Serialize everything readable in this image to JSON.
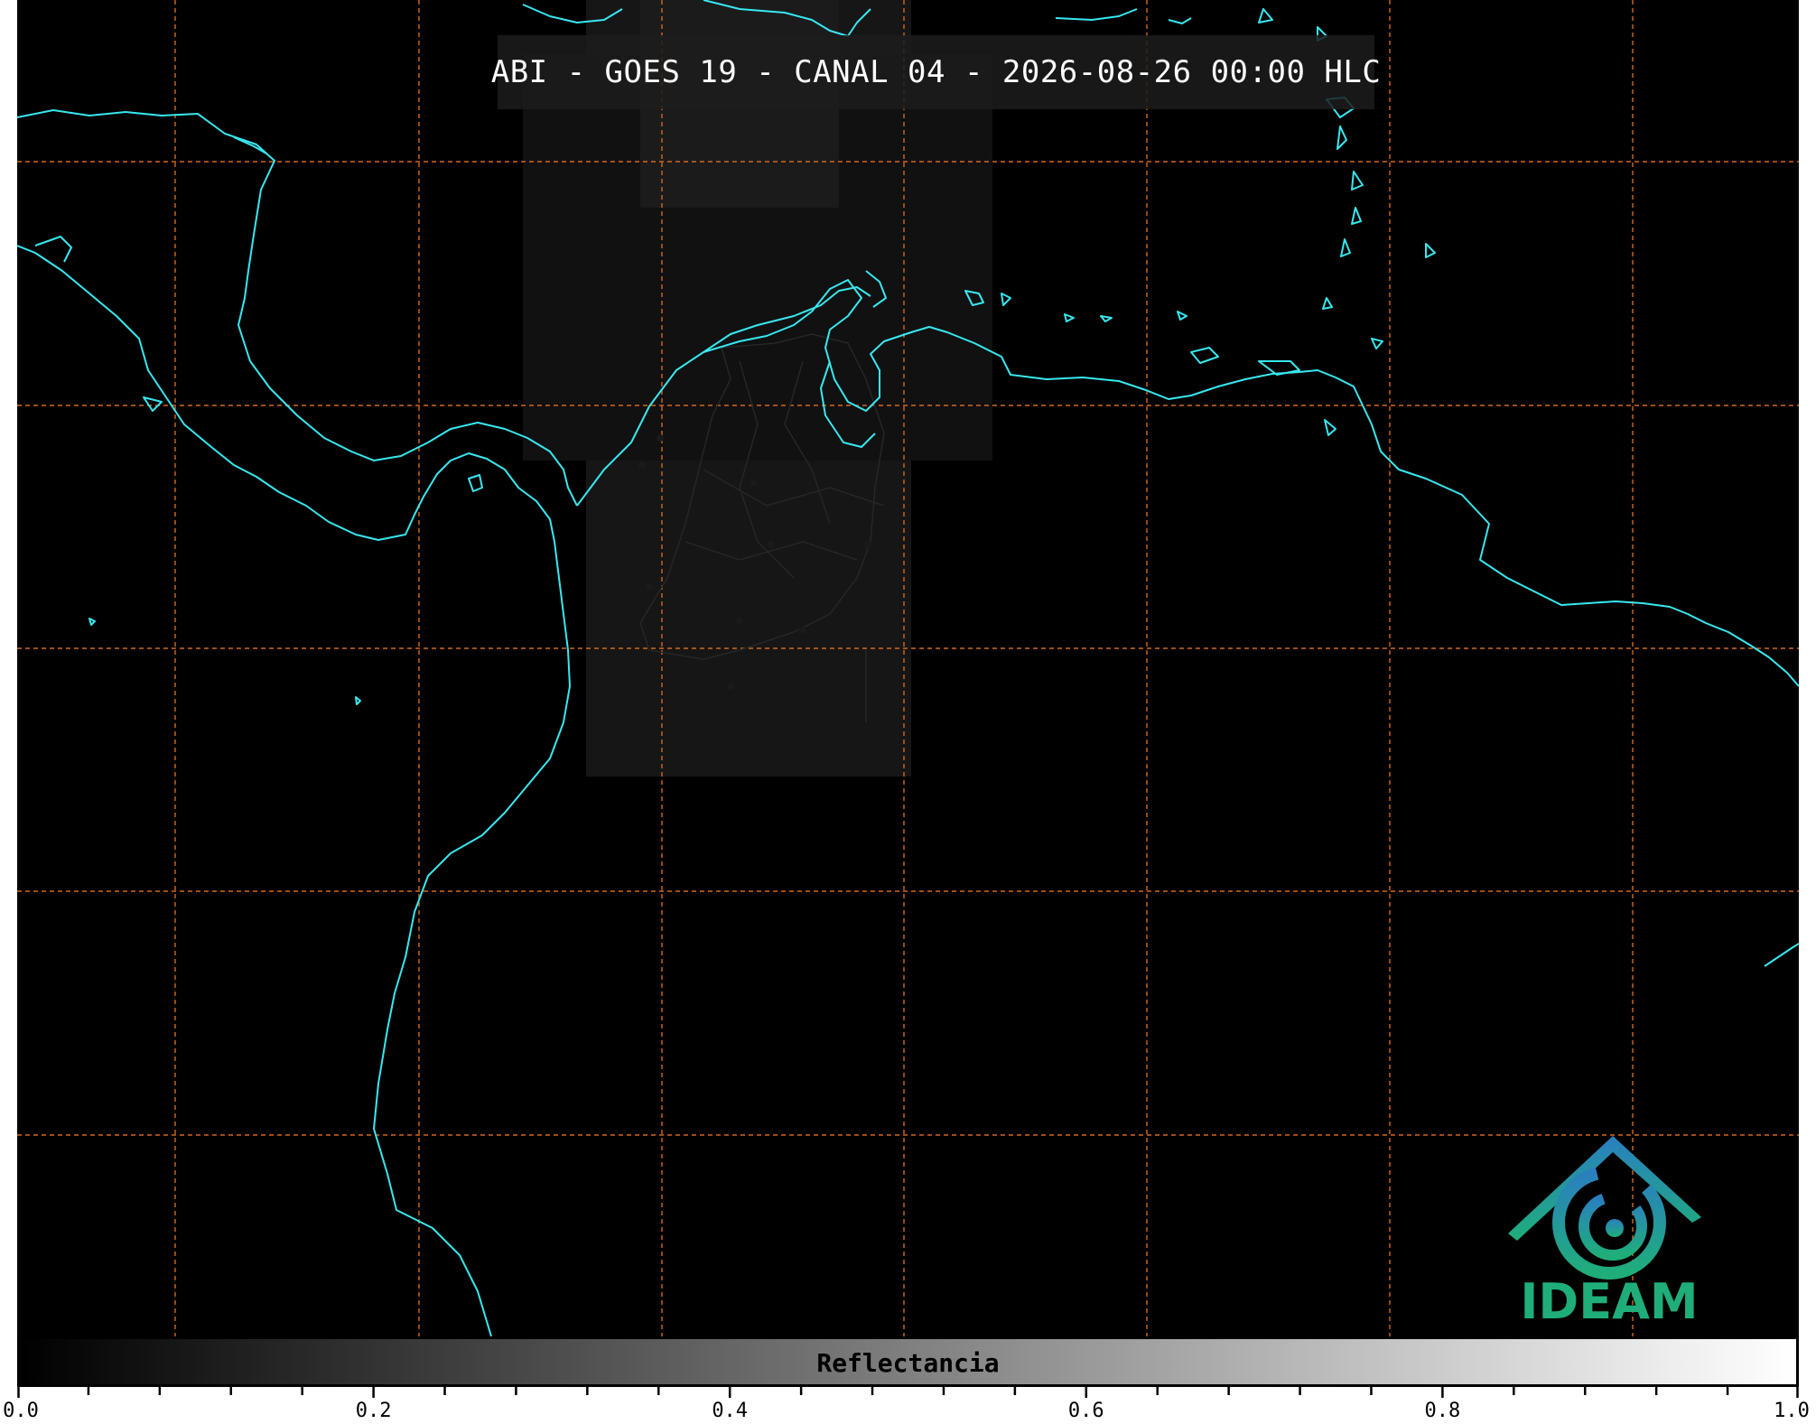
{
  "title": "ABI - GOES 19 - CANAL 04 - 2026-08-26 00:00 HLC",
  "colorbar": {
    "label": "Reflectancia",
    "min": 0.0,
    "max": 1.0,
    "tick_labels": [
      "0.0",
      "0.2",
      "0.4",
      "0.6",
      "0.8",
      "1.0"
    ],
    "minor_ticks_per_major": 4,
    "colormap": "grayscale black to white"
  },
  "logo": {
    "text": "IDEAM",
    "color_top": "#2a7fc0",
    "color_bottom": "#1fae7a"
  },
  "map": {
    "background": "#000000",
    "coastline_color": "#38e8f0",
    "gridline_color": "#d2691e",
    "border_color": "#202020",
    "features": [
      "coastline",
      "country-borders",
      "lat-lon-grid"
    ]
  }
}
